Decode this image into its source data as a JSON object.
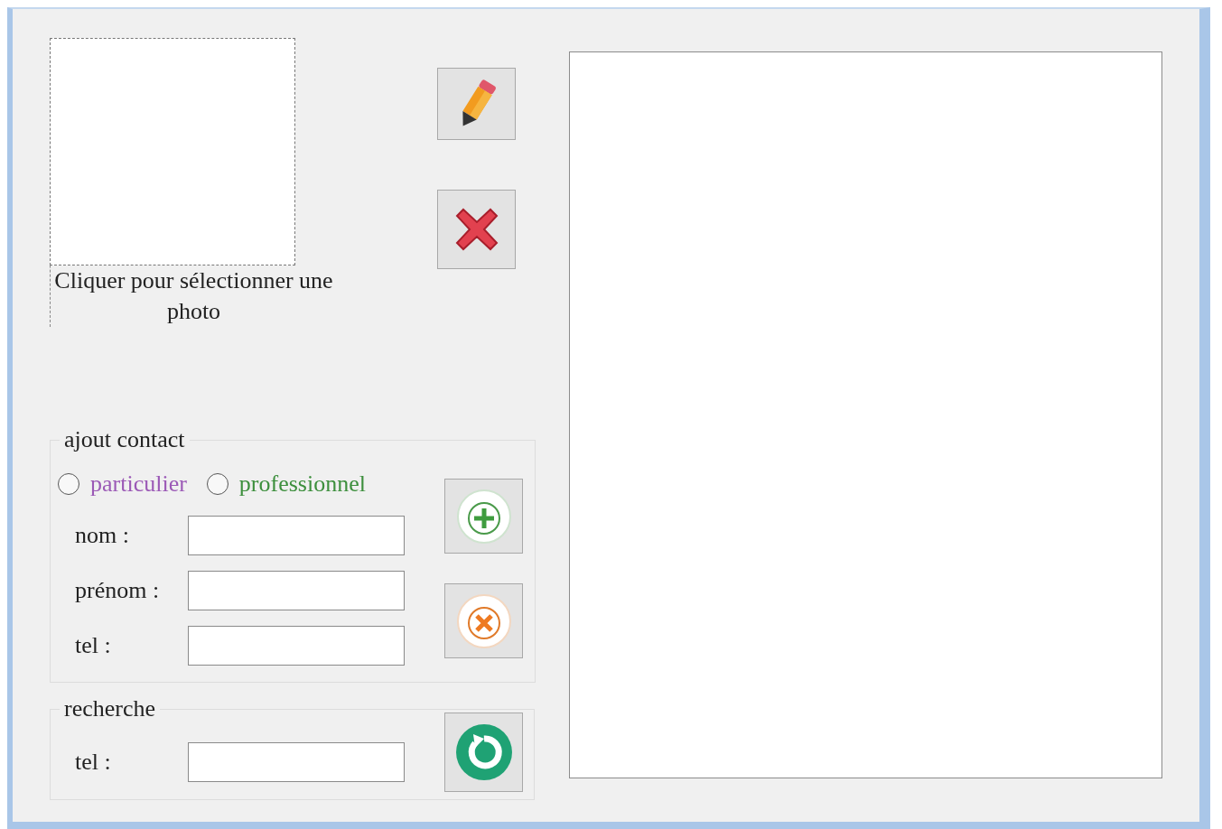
{
  "photo": {
    "caption": "Cliquer pour sélectionner une photo"
  },
  "photo_buttons": [
    {
      "kind": "edit"
    },
    {
      "kind": "delete"
    }
  ],
  "ajout_contact": {
    "title": "ajout contact",
    "types": [
      {
        "label": "particulier",
        "selected": false,
        "color": "#9b59b6"
      },
      {
        "label": "professionnel",
        "selected": false,
        "color": "#3d8f3d"
      }
    ],
    "fields": [
      {
        "label": "nom :"
      },
      {
        "label": "prénom :"
      },
      {
        "label": "tel :"
      }
    ],
    "buttons": [
      {
        "kind": "add"
      },
      {
        "kind": "cancel"
      }
    ]
  },
  "recherche": {
    "title": "recherche",
    "fields": [
      {
        "label": "tel :"
      }
    ],
    "buttons": [
      {
        "kind": "refresh"
      }
    ]
  }
}
